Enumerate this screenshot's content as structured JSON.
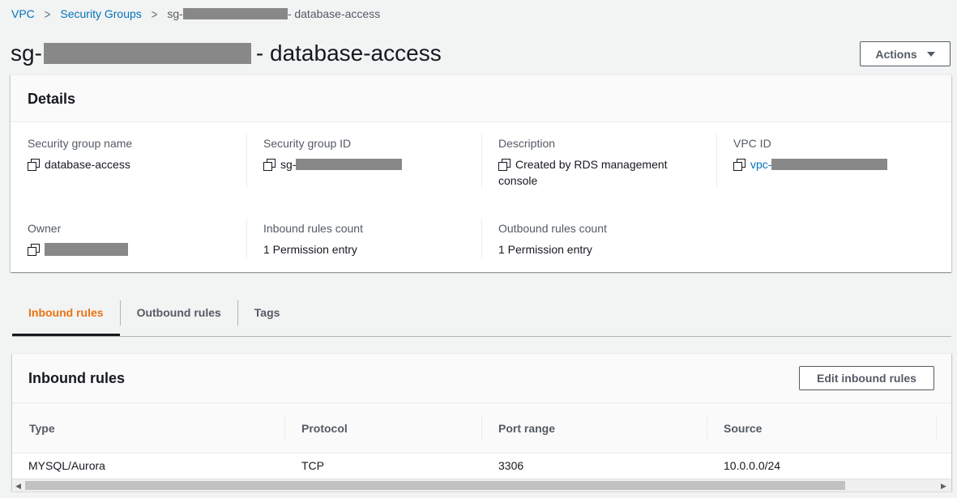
{
  "breadcrumb": {
    "items": [
      "VPC",
      "Security Groups"
    ],
    "current_prefix": "sg-",
    "current_suffix": "- database-access"
  },
  "page": {
    "title_prefix": "sg-",
    "title_suffix": "- database-access",
    "actions_label": "Actions"
  },
  "details": {
    "header": "Details",
    "fields": {
      "sg_name": {
        "label": "Security group name",
        "value": "database-access"
      },
      "sg_id": {
        "label": "Security group ID",
        "value": "sg-"
      },
      "description": {
        "label": "Description",
        "value_line1": "Created by RDS management",
        "value_line2": "console"
      },
      "vpc_id": {
        "label": "VPC ID",
        "value": "vpc-"
      },
      "owner": {
        "label": "Owner",
        "value": ""
      },
      "inbound_count": {
        "label": "Inbound rules count",
        "value": "1 Permission entry"
      },
      "outbound_count": {
        "label": "Outbound rules count",
        "value": "1 Permission entry"
      }
    }
  },
  "tabs": [
    {
      "label": "Inbound rules",
      "active": true
    },
    {
      "label": "Outbound rules",
      "active": false
    },
    {
      "label": "Tags",
      "active": false
    }
  ],
  "inbound": {
    "title": "Inbound rules",
    "edit_label": "Edit inbound rules",
    "columns": [
      "Type",
      "Protocol",
      "Port range",
      "Source"
    ],
    "rows": [
      [
        "MYSQL/Aurora",
        "TCP",
        "3306",
        "10.0.0.0/24"
      ]
    ]
  },
  "colors": {
    "link": "#0073bb",
    "active_tab": "#ec7211",
    "redaction": "#888888"
  }
}
